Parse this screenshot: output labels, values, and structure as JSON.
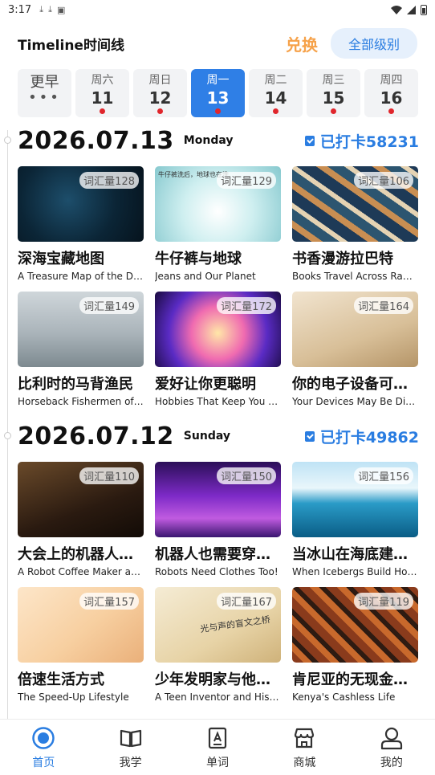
{
  "status_bar": {
    "time": "3:17"
  },
  "header": {
    "title": "Timeline时间线",
    "exchange_label": "兑换",
    "levels_label": "全部级别"
  },
  "day_strip": {
    "earlier_label": "更早",
    "earlier_dots": "•••",
    "days": [
      {
        "weekday": "周六",
        "date": "11",
        "has_dot": true,
        "active": false
      },
      {
        "weekday": "周日",
        "date": "12",
        "has_dot": true,
        "active": false
      },
      {
        "weekday": "周一",
        "date": "13",
        "has_dot": true,
        "active": true
      },
      {
        "weekday": "周二",
        "date": "14",
        "has_dot": true,
        "active": false
      },
      {
        "weekday": "周三",
        "date": "15",
        "has_dot": true,
        "active": false
      },
      {
        "weekday": "周四",
        "date": "16",
        "has_dot": true,
        "active": false
      }
    ]
  },
  "sections": [
    {
      "date": "2026.07.13",
      "weekday": "Monday",
      "checkin": "已打卡58231",
      "articles": [
        {
          "vocab": "词汇量128",
          "title_cn": "深海宝藏地图",
          "title_en": "A Treasure Map of the Deep",
          "thumb": "t-map"
        },
        {
          "vocab": "词汇量129",
          "title_cn": "牛仔裤与地球",
          "title_en": "Jeans and Our Planet",
          "thumb": "t-jeans",
          "thumb_text": "牛仔裤洗后，地球也在洗"
        },
        {
          "vocab": "词汇量106",
          "title_cn": "书香漫游拉巴特",
          "title_en": "Books Travel Across Rabat",
          "thumb": "t-books"
        },
        {
          "vocab": "词汇量149",
          "title_cn": "比利时的马背渔民",
          "title_en": "Horseback Fishermen of Belgium",
          "thumb": "t-horse"
        },
        {
          "vocab": "词汇量172",
          "title_cn": "爱好让你更聪明",
          "title_en": "Hobbies That Keep You Sharp",
          "thumb": "t-brain"
        },
        {
          "vocab": "词汇量164",
          "title_cn": "你的电子设备可能很脏",
          "title_en": "Your Devices May Be Dirty",
          "thumb": "t-devices"
        }
      ]
    },
    {
      "date": "2026.07.12",
      "weekday": "Sunday",
      "checkin": "已打卡49862",
      "articles": [
        {
          "vocab": "词汇量110",
          "title_cn": "大会上的机器人咖啡师",
          "title_en": "A Robot Coffee Maker at the Expo",
          "thumb": "t-robot"
        },
        {
          "vocab": "词汇量150",
          "title_cn": "机器人也需要穿衣服",
          "title_en": "Robots Need Clothes Too!",
          "thumb": "t-runway"
        },
        {
          "vocab": "词汇量156",
          "title_cn": "当冰山在海底建造家园",
          "title_en": "When Icebergs Build Homes",
          "thumb": "t-ice"
        },
        {
          "vocab": "词汇量157",
          "title_cn": "倍速生活方式",
          "title_en": "The Speed-Up Lifestyle",
          "thumb": "t-speed"
        },
        {
          "vocab": "词汇量167",
          "title_cn": "少年发明家与他的盲文之桥",
          "title_en": "A Teen Inventor and His Bridge",
          "thumb": "t-inventor",
          "thumb_text": "光与声的盲文之桥"
        },
        {
          "vocab": "词汇量119",
          "title_cn": "肯尼亚的无现金生活",
          "title_en": "Kenya's Cashless Life",
          "thumb": "t-kenya"
        }
      ]
    }
  ],
  "bottom_nav": [
    {
      "label": "首页",
      "icon": "home-icon",
      "active": true
    },
    {
      "label": "我学",
      "icon": "book-icon",
      "active": false
    },
    {
      "label": "单词",
      "icon": "word-card-icon",
      "active": false
    },
    {
      "label": "商城",
      "icon": "store-icon",
      "active": false
    },
    {
      "label": "我的",
      "icon": "profile-icon",
      "active": false
    }
  ],
  "colors": {
    "accent": "#2a7de1",
    "active_day": "#2f7fe6",
    "exchange": "#f6a24a",
    "dot": "#e0262c"
  }
}
